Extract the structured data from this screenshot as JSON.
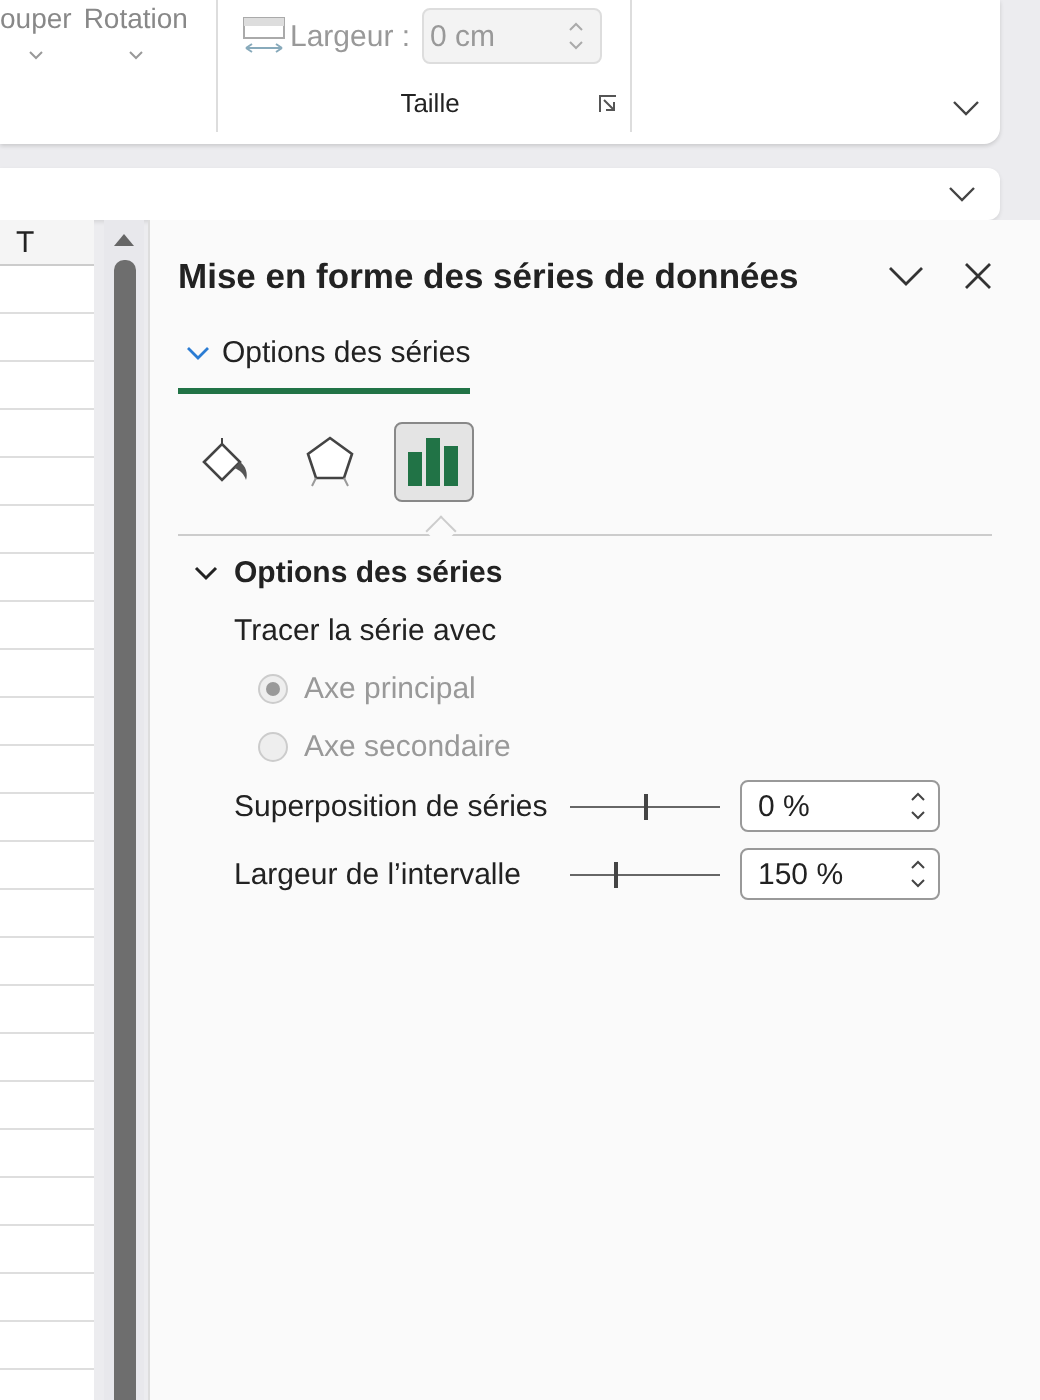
{
  "ribbon": {
    "buttons": [
      {
        "label": "ouper"
      },
      {
        "label": "Rotation"
      }
    ],
    "size_group": {
      "label": "Taille",
      "field_label": "Largeur :",
      "field_value": "0 cm",
      "disabled": true
    }
  },
  "sheet": {
    "columns": [
      "T"
    ]
  },
  "pane": {
    "title": "Mise en forme des séries de données",
    "tabs": [
      {
        "label": "Options des séries",
        "selected": true
      }
    ],
    "icon_tabs": [
      {
        "kind": "fill",
        "selected": false
      },
      {
        "kind": "effects",
        "selected": false
      },
      {
        "kind": "series",
        "selected": true
      }
    ],
    "section": {
      "title": "Options des séries",
      "expanded": true,
      "label": "Tracer la série avec",
      "radios": [
        {
          "label": "Axe principal",
          "selected": true,
          "disabled": true
        },
        {
          "label": "Axe secondaire",
          "selected": false,
          "disabled": true
        }
      ],
      "sliders": [
        {
          "label": "Superposition de séries",
          "level": 0.5,
          "value": "0 %"
        },
        {
          "label": "Largeur de l’intervalle",
          "level": 0.3,
          "value": "150 %"
        }
      ]
    }
  }
}
